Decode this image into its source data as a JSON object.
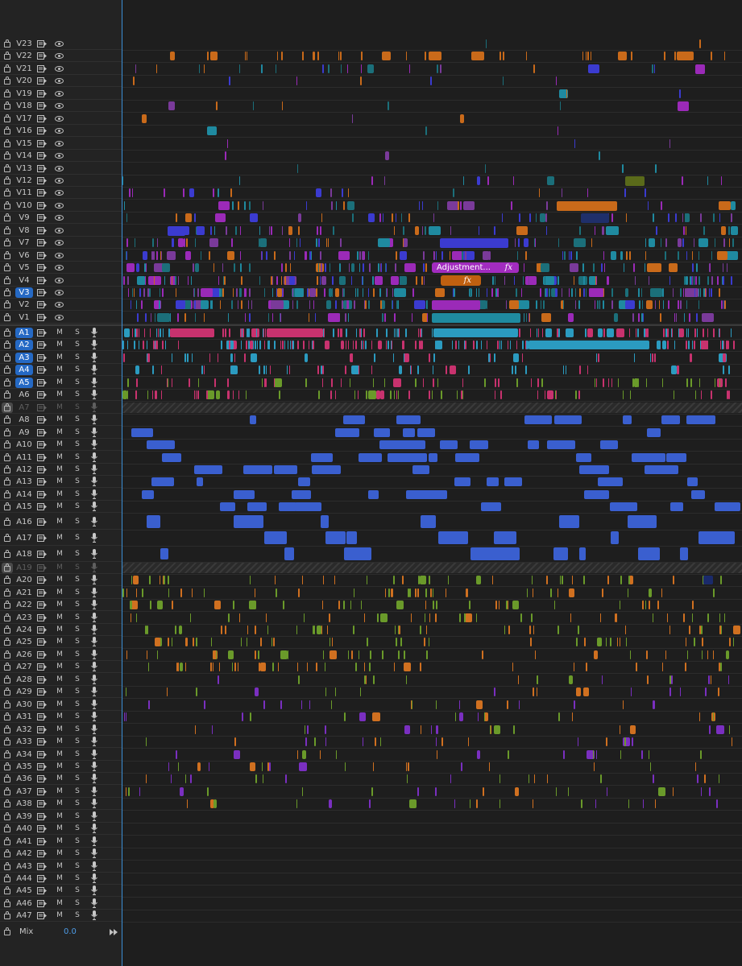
{
  "video_tracks": [
    "V23",
    "V22",
    "V21",
    "V20",
    "V19",
    "V18",
    "V17",
    "V16",
    "V15",
    "V14",
    "V13",
    "V12",
    "V11",
    "V10",
    "V9",
    "V8",
    "V7",
    "V6",
    "V5",
    "V4",
    "V3",
    "V2",
    "V1"
  ],
  "targeted_video": "V3",
  "audio_tracks": [
    "A1",
    "A2",
    "A3",
    "A4",
    "A5",
    "A6",
    "A7",
    "A8",
    "A9",
    "A10",
    "A11",
    "A12",
    "A13",
    "A14",
    "A15",
    "A16",
    "A17",
    "A18",
    "A19",
    "A20",
    "A21",
    "A22",
    "A23",
    "A24",
    "A25",
    "A26",
    "A27",
    "A28",
    "A29",
    "A30",
    "A31",
    "A32",
    "A33",
    "A34",
    "A35",
    "A36",
    "A37",
    "A38",
    "A39",
    "A40",
    "A41",
    "A42",
    "A43",
    "A44",
    "A45",
    "A46",
    "A47"
  ],
  "targeted_audio": [
    "A1",
    "A2",
    "A3",
    "A4",
    "A5"
  ],
  "disabled_audio": [
    "A7",
    "A19"
  ],
  "audio_button_mute": "M",
  "audio_button_solo": "S",
  "mix": {
    "label": "Mix",
    "value": "0.0"
  },
  "adjustment_clip": {
    "label": "Adjustment...",
    "fx": "fx"
  },
  "orange_fx_clip": {
    "fx": "fx"
  },
  "colors": {
    "video_magenta": "#9b2ab8",
    "video_cyan": "#1f8aa0",
    "video_orange": "#c96a1a",
    "video_blue": "#3b3bd0",
    "audio_pink": "#c8326e",
    "audio_cyan": "#2b9bc0",
    "audio_blue": "#3a5fcf",
    "audio_green": "#6a9a2a",
    "audio_orange": "#d07020",
    "target_blue": "#2569c4",
    "playhead": "#3b8fd6"
  },
  "icons": {
    "lock": "lock-icon",
    "sync": "sync-lock-icon",
    "eye": "eye-icon",
    "mic": "microphone-icon"
  }
}
